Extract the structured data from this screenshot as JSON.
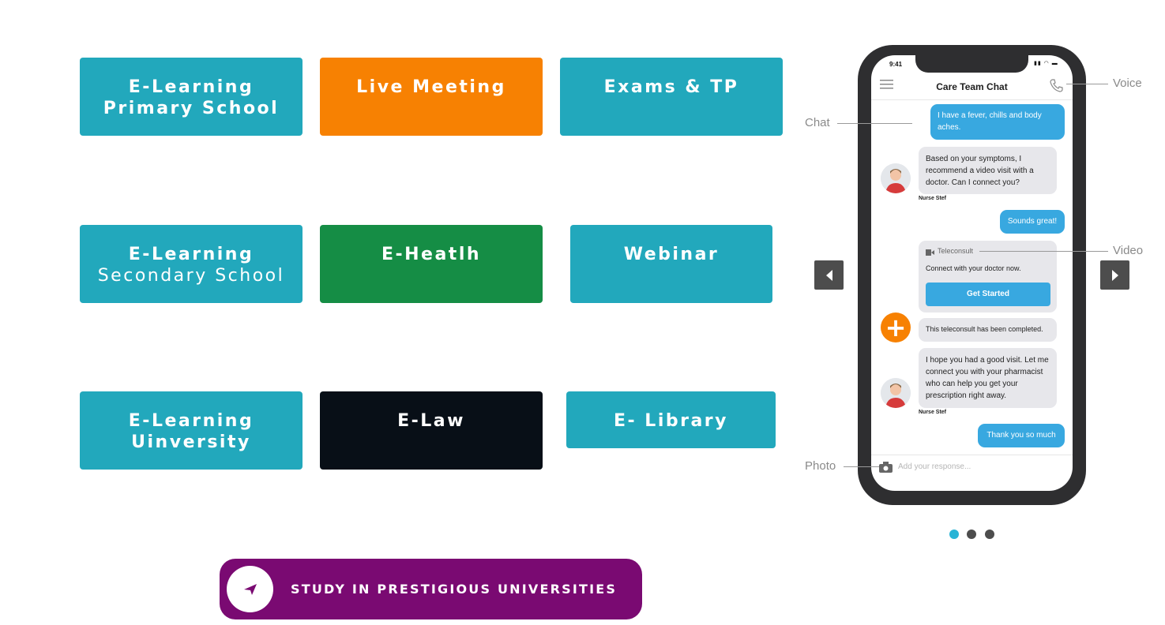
{
  "tiles": {
    "primary": {
      "line1": "E-Learning",
      "line2": "Primary School",
      "color": "#22a8bc"
    },
    "live": {
      "label": "Live Meeting",
      "color": "#f78102"
    },
    "exams": {
      "label": "Exams & TP",
      "color": "#22a8bc"
    },
    "secondary": {
      "line1": "E-Learning",
      "line2": "Secondary School",
      "color": "#22a8bc"
    },
    "health": {
      "label": "E-Heatlh",
      "color": "#158d45"
    },
    "webinar": {
      "label": "Webinar",
      "color": "#22a8bc"
    },
    "university": {
      "line1": "E-Learning",
      "line2": "Uinversity",
      "color": "#22a8bc"
    },
    "law": {
      "label": "E-Law",
      "color": "#080f17"
    },
    "library": {
      "label": "E- Library",
      "color": "#22a8bc"
    }
  },
  "cta": {
    "label": "STUDY IN PRESTIGIOUS UNIVERSITIES",
    "icon": "paper-plane-icon",
    "color": "#7a0a72"
  },
  "carousel": {
    "prev_icon": "chevron-left-icon",
    "next_icon": "chevron-right-icon",
    "active_dot": 1,
    "dot_count": 3,
    "callouts": {
      "voice": "Voice",
      "chat": "Chat",
      "video": "Video",
      "photo": "Photo"
    },
    "phone": {
      "time": "9:41",
      "title": "Care Team Chat",
      "msg_fever": "I have a fever, chills and body aches.",
      "msg_symptoms": "Based on your symptoms, I recommend a video visit with a doctor. Can I connect you?",
      "sender_1": "Nurse Stef",
      "msg_sounds": "Sounds great!",
      "tele_header": "Teleconsult",
      "tele_text": "Connect with your doctor now.",
      "tele_button": "Get Started",
      "msg_completed": "This teleconsult has been completed.",
      "msg_hope": "I hope you had a good visit. Let me connect you with your pharmacist who can help you get your prescription right away.",
      "sender_2": "Nurse Stef",
      "msg_thanks": "Thank you so much",
      "composer_placeholder": "Add your response..."
    }
  }
}
